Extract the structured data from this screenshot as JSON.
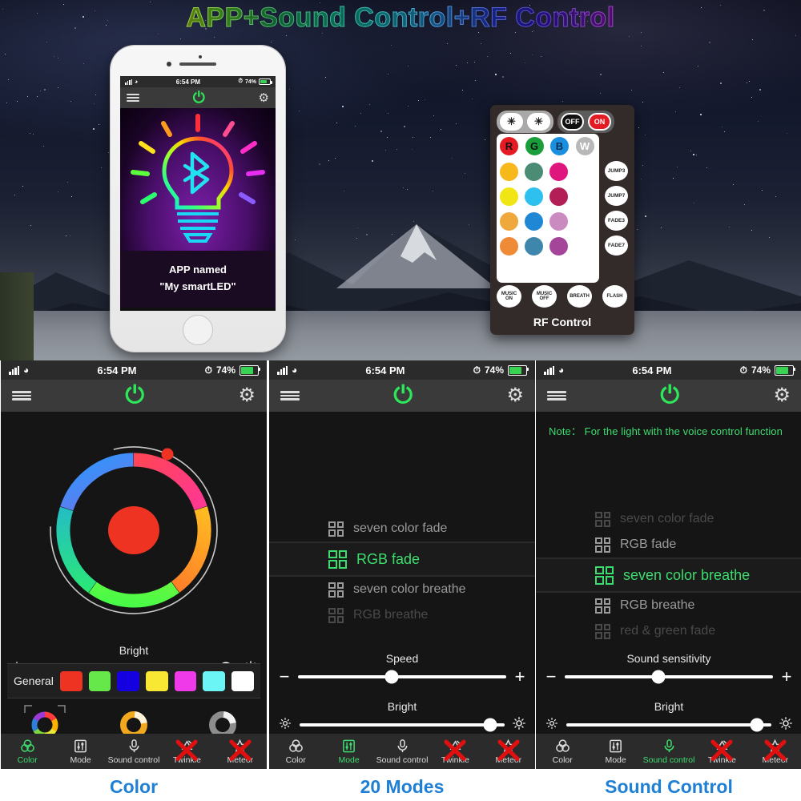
{
  "title": "APP+Sound Control+RF Control",
  "phone": {
    "status": {
      "time": "6:54 PM",
      "battery": "74%"
    },
    "appbar": {
      "menu_icon": "hamburger-sliders-icon",
      "power_icon": "power-icon",
      "settings_icon": "gear-icon"
    },
    "hero_icon": "rainbow-bulb-bluetooth-icon",
    "caption_line1": "APP named",
    "caption_line2": "\"My smartLED\""
  },
  "remote": {
    "caption": "RF Control",
    "top_buttons": [
      {
        "label": "☀",
        "name": "brightness-down-button"
      },
      {
        "label": "☀",
        "name": "brightness-up-button"
      },
      {
        "label": "OFF",
        "name": "off-button"
      },
      {
        "label": "ON",
        "name": "on-button"
      }
    ],
    "rgbw": [
      {
        "label": "R",
        "color": "#e41b23"
      },
      {
        "label": "G",
        "color": "#1a9e3c"
      },
      {
        "label": "B",
        "color": "#1a8fe0"
      },
      {
        "label": "W",
        "color": "#b8b8b8"
      }
    ],
    "color_grid": [
      "#f7b81c",
      "#4a8c74",
      "#e0167f",
      "#f2e516",
      "#2ec0ef",
      "#b41e56",
      "#efa83c",
      "#1f87d4",
      "#c98bc0",
      "#ef8a36",
      "#3f86ad",
      "#a4459a"
    ],
    "fade_buttons": [
      "JUMP3",
      "JUMP7",
      "FADE3",
      "FADE7"
    ],
    "bottom_buttons": [
      "MUSIC ON",
      "MUSIC OFF",
      "BREATH",
      "FLASH"
    ]
  },
  "panels": [
    {
      "caption": "Color",
      "status": {
        "time": "6:54 PM",
        "battery": "74%"
      },
      "general_label": "General",
      "swatches": [
        "#ee3322",
        "#66e84a",
        "#1400e0",
        "#f9e833",
        "#ee3ae8",
        "#6cf5f5",
        "#ffffff"
      ],
      "ring_presets": [
        "rainbow-ring",
        "warm-ring",
        "cool-ring"
      ],
      "sliders": [
        {
          "label": "Bright",
          "value": 95,
          "left_icon": "brightness-low-icon",
          "right_icon": "brightness-high-icon"
        }
      ],
      "tabs": [
        {
          "label": "Color",
          "icon": "color-rings-icon",
          "active": true,
          "crossed": false
        },
        {
          "label": "Mode",
          "icon": "sliders-icon",
          "active": false,
          "crossed": false
        },
        {
          "label": "Sound control",
          "icon": "microphone-icon",
          "active": false,
          "crossed": false
        },
        {
          "label": "Twinkle",
          "icon": "twinkle-icon",
          "active": false,
          "crossed": true
        },
        {
          "label": "Meteor",
          "icon": "meteor-star-icon",
          "active": false,
          "crossed": true
        }
      ]
    },
    {
      "caption": "20 Modes",
      "status": {
        "time": "6:54 PM",
        "battery": "74%"
      },
      "modes": [
        {
          "label": "seven color fade",
          "state": "dim"
        },
        {
          "label": "RGB fade",
          "state": "selected"
        },
        {
          "label": "seven color breathe",
          "state": "dim"
        },
        {
          "label": "RGB breathe",
          "state": "faint"
        }
      ],
      "sliders": [
        {
          "label": "Speed",
          "value": 45,
          "left_icon": "minus-icon",
          "right_icon": "plus-icon"
        },
        {
          "label": "Bright",
          "value": 93,
          "left_icon": "brightness-low-icon",
          "right_icon": "brightness-high-icon"
        }
      ],
      "tabs": [
        {
          "label": "Color",
          "icon": "color-rings-icon",
          "active": false,
          "crossed": false
        },
        {
          "label": "Mode",
          "icon": "sliders-icon",
          "active": true,
          "crossed": false
        },
        {
          "label": "Sound control",
          "icon": "microphone-icon",
          "active": false,
          "crossed": false
        },
        {
          "label": "Twinkle",
          "icon": "twinkle-icon",
          "active": false,
          "crossed": true
        },
        {
          "label": "Meteor",
          "icon": "meteor-star-icon",
          "active": false,
          "crossed": true
        }
      ]
    },
    {
      "caption": "Sound Control",
      "status": {
        "time": "6:54 PM",
        "battery": "74%"
      },
      "note": "Note： For the light with the voice control function",
      "modes": [
        {
          "label": "seven color fade",
          "state": "faint"
        },
        {
          "label": "RGB fade",
          "state": "dim"
        },
        {
          "label": "seven color breathe",
          "state": "selected"
        },
        {
          "label": "RGB breathe",
          "state": "dim"
        },
        {
          "label": "red & green fade",
          "state": "faint"
        }
      ],
      "sliders": [
        {
          "label": "Sound sensitivity",
          "value": 45,
          "left_icon": "minus-icon",
          "right_icon": "plus-icon"
        },
        {
          "label": "Bright",
          "value": 93,
          "left_icon": "brightness-low-icon",
          "right_icon": "brightness-high-icon"
        }
      ],
      "tabs": [
        {
          "label": "Color",
          "icon": "color-rings-icon",
          "active": false,
          "crossed": false
        },
        {
          "label": "Mode",
          "icon": "sliders-icon",
          "active": false,
          "crossed": false
        },
        {
          "label": "Sound control",
          "icon": "microphone-icon",
          "active": true,
          "crossed": false
        },
        {
          "label": "Twinkle",
          "icon": "twinkle-icon",
          "active": false,
          "crossed": true
        },
        {
          "label": "Meteor",
          "icon": "meteor-star-icon",
          "active": false,
          "crossed": true
        }
      ]
    }
  ]
}
